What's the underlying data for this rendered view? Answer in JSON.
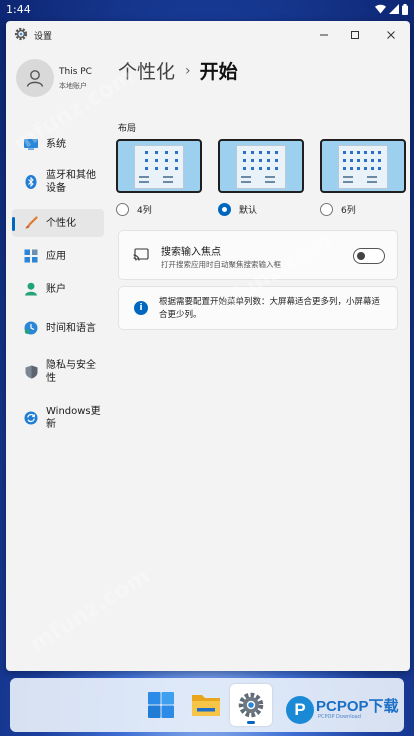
{
  "status_bar": {
    "time": "1:44"
  },
  "window": {
    "title": "设置",
    "controls": {
      "minimize": "—",
      "maximize": "▢",
      "close": "✕"
    }
  },
  "profile": {
    "name": "This PC",
    "account": "本地账户"
  },
  "sidebar": {
    "items": [
      {
        "label": "系统",
        "icon": "system-icon"
      },
      {
        "label": "蓝牙和其他设备",
        "icon": "bluetooth-icon"
      },
      {
        "label": "个性化",
        "icon": "brush-icon",
        "active": true
      },
      {
        "label": "应用",
        "icon": "apps-icon"
      },
      {
        "label": "账户",
        "icon": "account-icon"
      },
      {
        "label": "时间和语言",
        "icon": "time-language-icon"
      },
      {
        "label": "隐私与安全性",
        "icon": "shield-icon"
      },
      {
        "label": "Windows更新",
        "icon": "update-icon"
      }
    ]
  },
  "breadcrumb": {
    "parent": "个性化",
    "separator": "›",
    "current": "开始"
  },
  "layout": {
    "label": "布局",
    "options": [
      {
        "label": "4列",
        "selected": false
      },
      {
        "label": "默认",
        "selected": true
      },
      {
        "label": "6列",
        "selected": false
      }
    ]
  },
  "focus_setting": {
    "title": "搜索输入焦点",
    "description": "打开搜索应用时自动聚焦搜索输入框",
    "enabled": false
  },
  "info": {
    "text": "根据需要配置开始菜单列数：大屏幕适合更多列，小屏幕适合更少列。"
  },
  "watermarks": [
    "mfunz.com",
    "mfunz.com",
    "mfunz.com"
  ],
  "brand": {
    "name": "PCPOP下载",
    "logo_letter": "P",
    "subtitle": "PCPOP Download"
  },
  "colors": {
    "accent": "#0067c0",
    "window_bg": "#f3f3f3"
  }
}
